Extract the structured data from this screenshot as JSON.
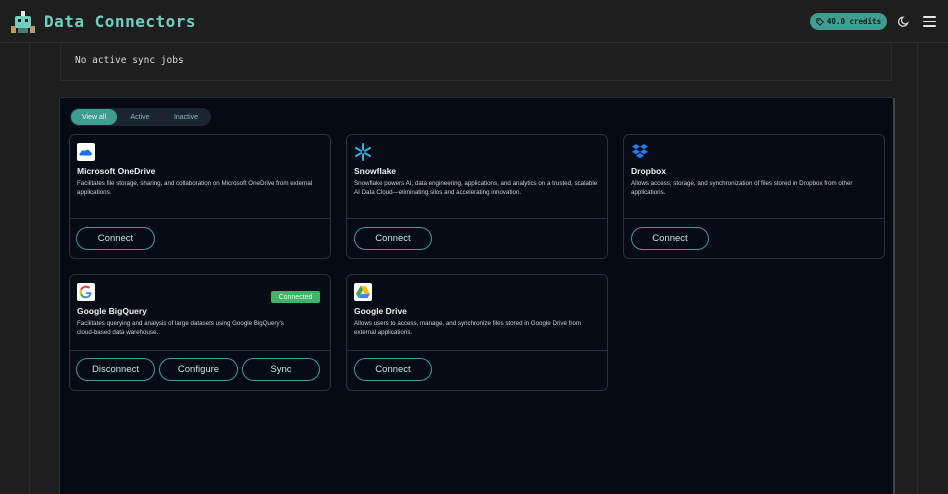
{
  "header": {
    "title": "Data Connectors",
    "credits": "40.0 credits",
    "logo_icon": "robot-logo-icon",
    "theme_icon": "moon-icon",
    "menu_icon": "hamburger-menu-icon"
  },
  "sync": {
    "status_text": "No active sync jobs"
  },
  "tabs": [
    {
      "label": "View all",
      "active": true
    },
    {
      "label": "Active",
      "active": false
    },
    {
      "label": "Inactive",
      "active": false
    }
  ],
  "connectors": [
    {
      "name": "Microsoft OneDrive",
      "description": "Facilitates file storage, sharing, and collaboration on Microsoft OneDrive from external applications.",
      "icon": "onedrive-icon",
      "buttons": [
        "Connect"
      ]
    },
    {
      "name": "Snowflake",
      "description": "Snowflake powers AI, data engineering, applications, and analytics on a trusted, scalable AI Data Cloud—eliminating silos and accelerating innovation.",
      "icon": "snowflake-icon",
      "buttons": [
        "Connect"
      ]
    },
    {
      "name": "Dropbox",
      "description": "Allows access, storage, and synchronization of files stored in Dropbox from other applications.",
      "icon": "dropbox-icon",
      "buttons": [
        "Connect"
      ]
    },
    {
      "name": "Google BigQuery",
      "description": "Facilitates querying and analysis of large datasets using Google BigQuery's cloud-based data warehouse.",
      "icon": "google-icon",
      "badge": "Connected",
      "buttons": [
        "Disconnect",
        "Configure",
        "Sync"
      ]
    },
    {
      "name": "Google Drive",
      "description": "Allows users to access, manage, and synchronize files stored in Google Drive from external applications.",
      "icon": "google-drive-icon",
      "buttons": [
        "Connect"
      ]
    }
  ],
  "colors": {
    "accent": "#3f9c8e",
    "title": "#6fd1bd",
    "connected_badge": "#3fb36a",
    "panel_bg": "#050a14"
  }
}
